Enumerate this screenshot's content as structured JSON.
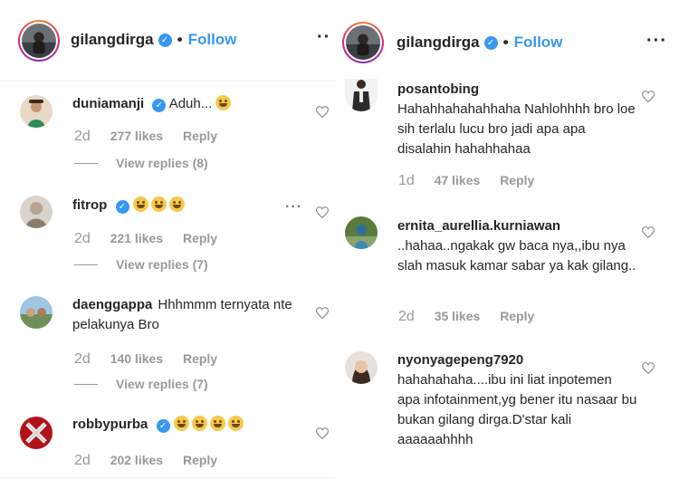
{
  "left": {
    "header": {
      "username": "gilangdirga",
      "dot": "•",
      "follow": "Follow",
      "more": "··"
    },
    "comments": [
      {
        "username": "duniamanji",
        "verified": true,
        "text": "Aduh...",
        "emoji_count": 1,
        "age": "2d",
        "likes": "277 likes",
        "reply": "Reply",
        "view_replies": "View replies (8)"
      },
      {
        "username": "fitrop",
        "verified": true,
        "text": "",
        "emoji_count": 3,
        "age": "2d",
        "likes": "221 likes",
        "reply": "Reply",
        "view_replies": "View replies (7)",
        "more": "···"
      },
      {
        "username": "daenggappa",
        "verified": false,
        "text": "Hhhmmm ternyata nte pelakunya Bro",
        "emoji_count": 0,
        "age": "2d",
        "likes": "140 likes",
        "reply": "Reply",
        "view_replies": "View replies (7)"
      },
      {
        "username": "robbypurba",
        "verified": true,
        "text": "",
        "emoji_count": 4,
        "age": "2d",
        "likes": "202 likes",
        "reply": "Reply"
      }
    ]
  },
  "right": {
    "header": {
      "username": "gilangdirga",
      "dot": "•",
      "follow": "Follow",
      "more": "···"
    },
    "comments": [
      {
        "username": "posantobing",
        "text": "Hahahhahahahhaha Nahlohhhh bro loe sih terlalu lucu bro jadi apa apa disalahin hahahhahaa",
        "age": "1d",
        "likes": "47 likes",
        "reply": "Reply"
      },
      {
        "username": "ernita_aurellia.kurniawan",
        "text": "..hahaa..ngakak gw baca nya,,ibu nya slah masuk kamar sabar ya kak gilang..",
        "age": "2d",
        "likes": "35 likes",
        "reply": "Reply"
      },
      {
        "username": "nyonyagepeng7920",
        "text": "hahahahaha....ibu ini liat inpotemen apa infotainment,yg bener itu nasaar bu bukan gilang dirga.D'star kali aaaaaahhhh"
      }
    ]
  },
  "colors": {
    "accent": "#3897f0",
    "muted": "#999999",
    "text": "#262626"
  }
}
